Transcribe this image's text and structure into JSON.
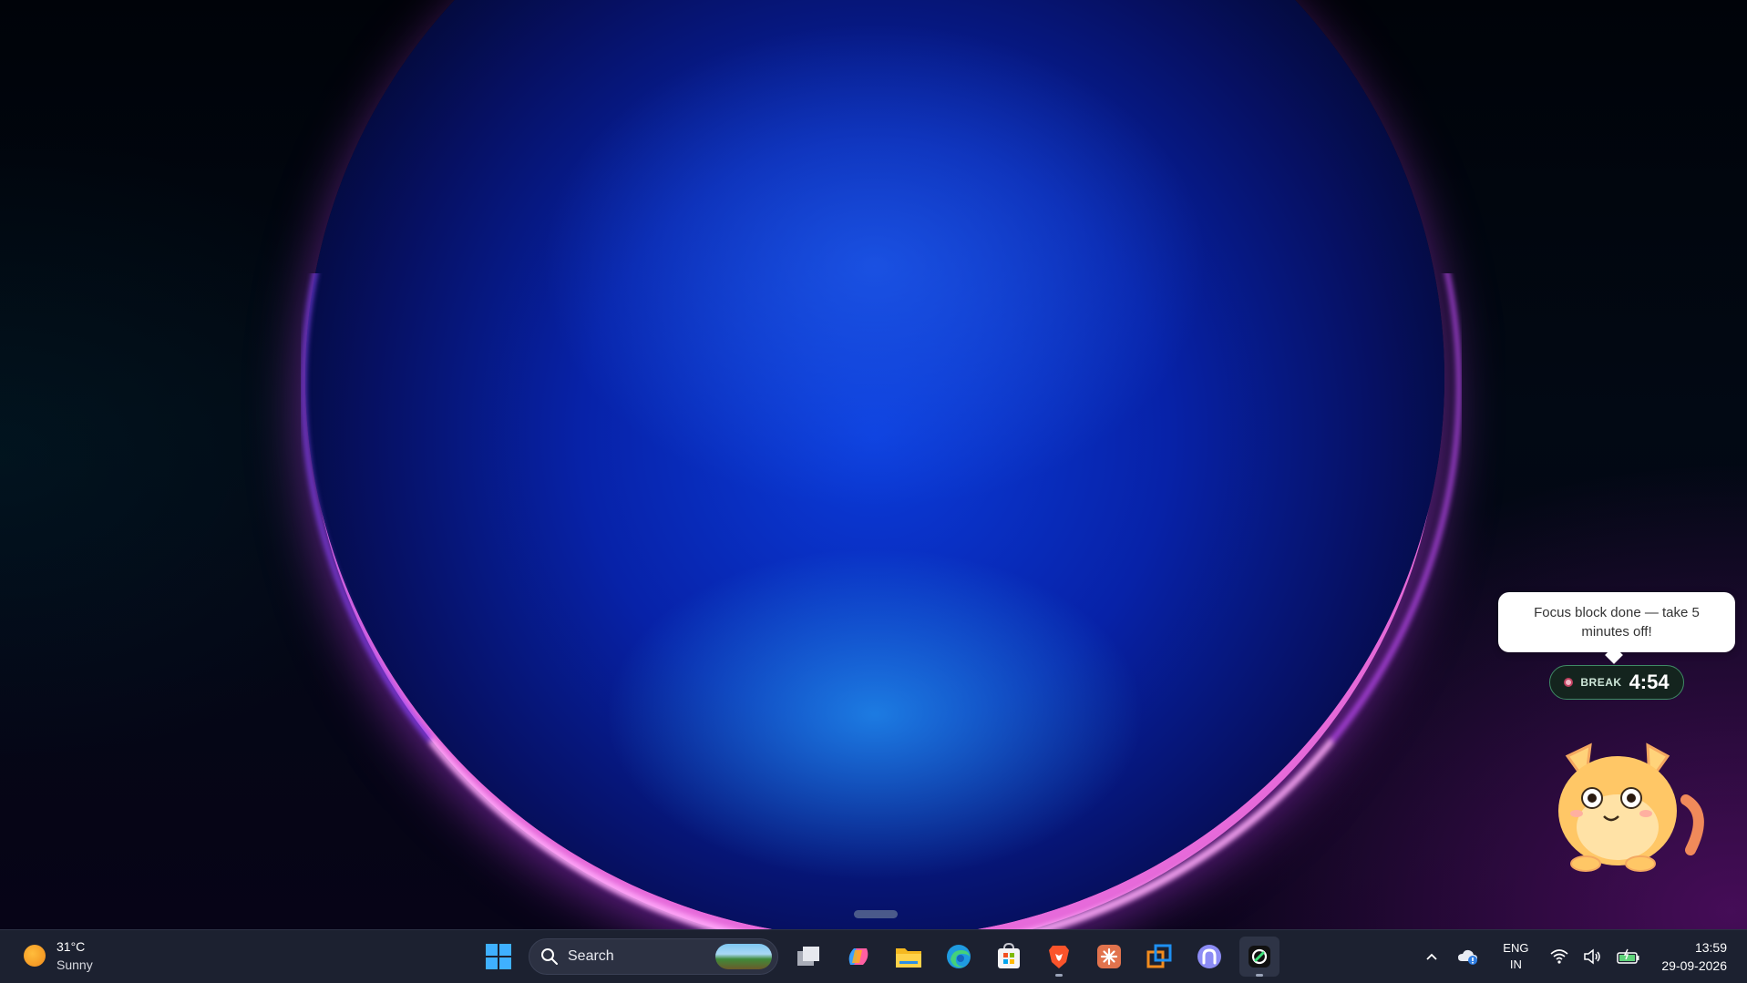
{
  "notification": {
    "message": "Focus block done — take 5 minutes off!"
  },
  "timer": {
    "label": "BREAK",
    "time": "4:54"
  },
  "taskbar": {
    "weather": {
      "temperature": "31°C",
      "condition": "Sunny",
      "icon": "sun-icon"
    },
    "search": {
      "placeholder": "Search"
    },
    "pinned_apps": [
      {
        "name": "windows-start-icon",
        "running": false
      },
      {
        "name": "task-view-icon",
        "running": false
      },
      {
        "name": "copilot-icon",
        "running": false
      },
      {
        "name": "file-explorer-icon",
        "running": false
      },
      {
        "name": "edge-icon",
        "running": false
      },
      {
        "name": "microsoft-store-icon",
        "running": false
      },
      {
        "name": "brave-icon",
        "running": true
      },
      {
        "name": "claude-icon",
        "running": false
      },
      {
        "name": "remote-desktop-icon",
        "running": false
      },
      {
        "name": "arc-icon",
        "running": false
      },
      {
        "name": "chatgpt-icon",
        "running": true
      }
    ],
    "tray": {
      "language_top": "ENG",
      "language_bottom": "IN",
      "time": "13:59",
      "date": "29-09-2026"
    }
  },
  "colors": {
    "taskbar_bg": "#1c2130",
    "timer_bg": "#14241e",
    "timer_border": "#3f8b65"
  }
}
